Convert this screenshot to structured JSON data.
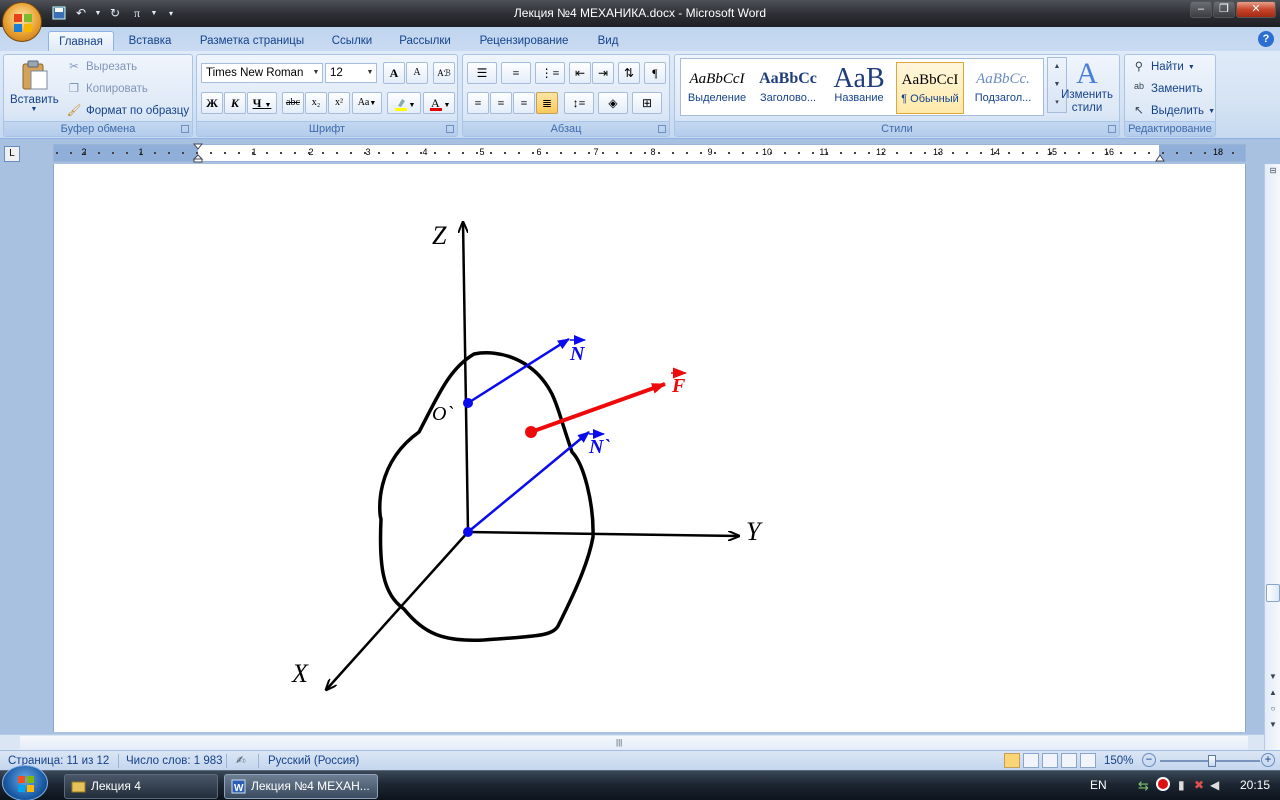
{
  "window": {
    "title": "Лекция №4 МЕХАНИКА.docx - Microsoft Word"
  },
  "tabs": [
    {
      "label": "Главная",
      "active": true
    },
    {
      "label": "Вставка"
    },
    {
      "label": "Разметка страницы"
    },
    {
      "label": "Ссылки"
    },
    {
      "label": "Рассылки"
    },
    {
      "label": "Рецензирование"
    },
    {
      "label": "Вид"
    }
  ],
  "ribbon": {
    "clipboard": {
      "label": "Буфер обмена",
      "paste": "Вставить",
      "cut": "Вырезать",
      "copy": "Копировать",
      "format_painter": "Формат по образцу"
    },
    "font": {
      "label": "Шрифт",
      "font_name": "Times New Roman",
      "font_size": "12",
      "bold": "Ж",
      "italic": "К",
      "underline": "Ч",
      "strike": "abc",
      "subscript": "x₂",
      "superscript": "x²",
      "change_case": "Aa",
      "grow": "A",
      "shrink": "A"
    },
    "paragraph": {
      "label": "Абзац",
      "show_marks": "¶"
    },
    "styles": {
      "label": "Стили",
      "items": [
        {
          "sample": "AaBbCcI",
          "name": "Выделение"
        },
        {
          "sample": "AaBbCc",
          "name": "Заголово..."
        },
        {
          "sample": "AaB",
          "name": "Название"
        },
        {
          "sample": "AaBbCcI",
          "name": "¶ Обычный",
          "selected": true
        },
        {
          "sample": "AaBbCc.",
          "name": "Подзагол..."
        }
      ],
      "change_styles": "Изменить стили"
    },
    "editing": {
      "label": "Редактирование",
      "find": "Найти",
      "replace": "Заменить",
      "select": "Выделить"
    }
  },
  "ruler": {
    "numbers": [
      "2",
      "1",
      "1",
      "2",
      "3",
      "4",
      "5",
      "6",
      "7",
      "8",
      "9",
      "10",
      "11",
      "12",
      "13",
      "14",
      "15",
      "16",
      "18"
    ]
  },
  "diagram": {
    "axis_z": "Z",
    "axis_y": "Y",
    "axis_x": "X",
    "point_o": "O`",
    "vec_n1": "N",
    "vec_f": "F",
    "vec_n2": "N`",
    "colors": {
      "axes": "#000000",
      "normal": "#0a0aee",
      "force": "#ee0a0a"
    }
  },
  "statusbar": {
    "page": "Страница: 11 из 12",
    "words": "Число слов: 1 983",
    "language": "Русский (Россия)",
    "zoom": "150%"
  },
  "taskbar": {
    "tasks": [
      {
        "label": "Лекция 4"
      },
      {
        "label": "Лекция №4 МЕХАН...",
        "active": true
      }
    ],
    "lang": "EN",
    "time": "20:15"
  }
}
